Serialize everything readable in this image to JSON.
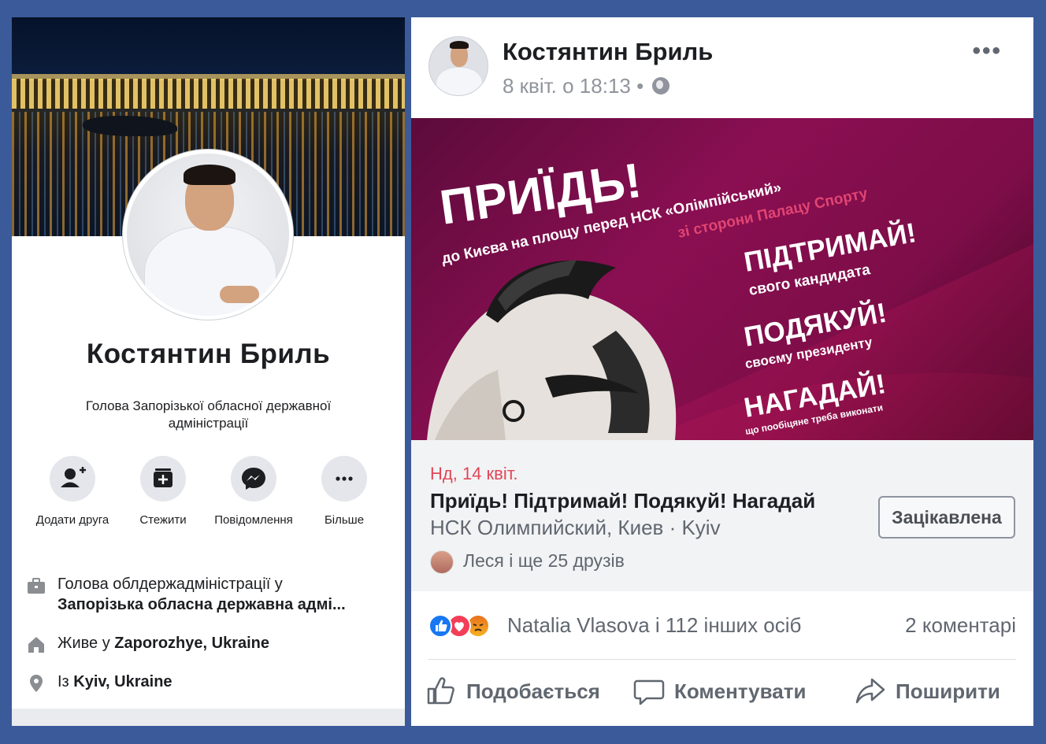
{
  "profile": {
    "name": "Костянтин Бриль",
    "subtitle": "Голова Запорізької обласної державної адміністрації",
    "actions": [
      {
        "label": "Додати друга",
        "icon": "add-friend-icon"
      },
      {
        "label": "Стежити",
        "icon": "follow-icon"
      },
      {
        "label": "Повідомлення",
        "icon": "messenger-icon"
      },
      {
        "label": "Більше",
        "icon": "more-icon"
      }
    ],
    "info": {
      "work_prefix": "Голова облдержадміністрації у",
      "work_org": "Запорізька обласна державна адмі...",
      "lives_prefix": "Живе у ",
      "lives_place": "Zaporozhye, Ukraine",
      "from_prefix": "Із ",
      "from_place": "Kyiv, Ukraine"
    }
  },
  "post": {
    "author": "Костянтин Бриль",
    "time": "8 квіт. о 18:13 •",
    "more": "•••",
    "banner": {
      "headline": "ПРИЇДЬ!",
      "line1": "до Києва на площу перед НСК «Олімпійський»",
      "line2": "зі сторони Палацу Спорту",
      "cta1": "ПІДТРИМАЙ!",
      "cta1_sub": "свого кандидата",
      "cta2": "ПОДЯКУЙ!",
      "cta2_sub": "своєму президенту",
      "cta3": "НАГАДАЙ!",
      "cta3_sub": "що пообіцяне треба виконати"
    },
    "event": {
      "date": "Нд, 14 квіт.",
      "title": "Приїдь! Підтримай! Подякуй! Нагадай",
      "place": "НСК Олимпийский, Киев · Kyiv",
      "friends": "Леся і ще 25 друзів",
      "interested": "Зацікавлена"
    },
    "reactions": {
      "text": "Natalia Vlasova і 112 інших осіб",
      "comments": "2 коментарі"
    },
    "buttons": {
      "like": "Подобається",
      "comment": "Коментувати",
      "share": "Поширити"
    }
  },
  "colors": {
    "background": "#3b5a9a",
    "event_date": "#e04757",
    "banner": "#8a0f52",
    "like_blue": "#1877f2"
  }
}
